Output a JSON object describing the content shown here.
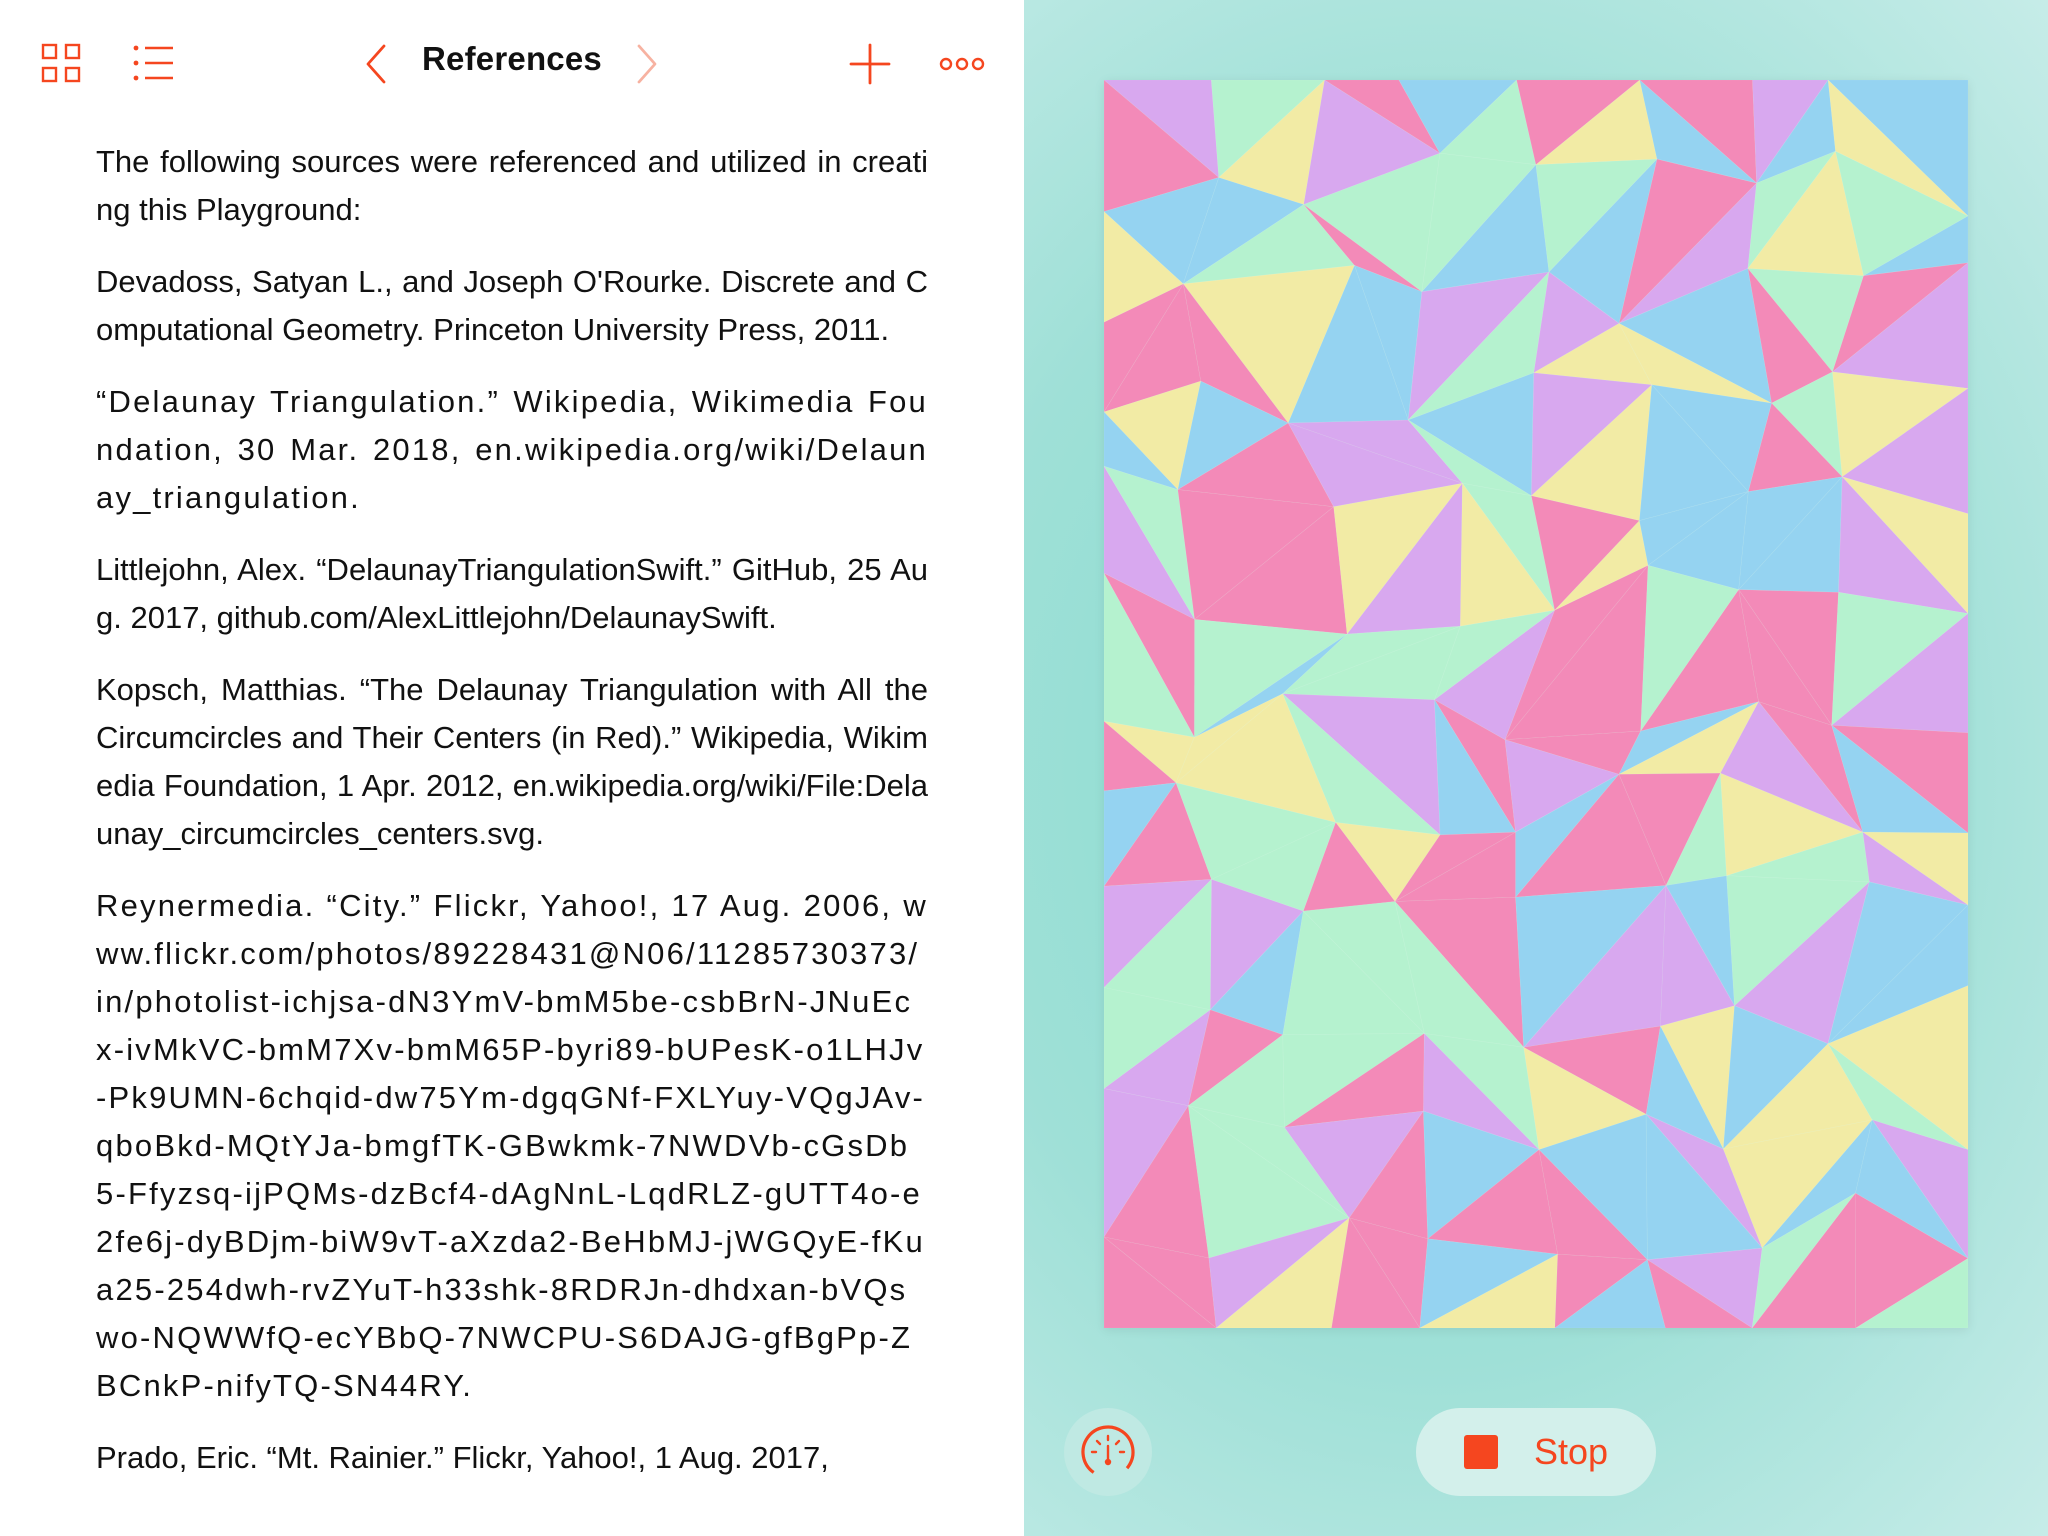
{
  "toolbar": {
    "title": "References",
    "icons": {
      "grid": "grid-view-icon",
      "list": "list-view-icon",
      "back": "chevron-left-icon",
      "forward": "chevron-right-icon",
      "add": "plus-icon",
      "more": "more-icon"
    }
  },
  "document": {
    "paragraphs": [
      "The following sources were referenced and utilized in creating this Playground:",
      "Devadoss, Satyan L., and Joseph O'Rourke. Discrete and Computational Geometry. Princeton University Press, 2011.",
      "“Delaunay Triangulation.” Wikipedia, Wikimedia Foundation, 30 Mar. 2018, en.wikipedia.org/wiki/Delaunay_triangulation.",
      "Littlejohn, Alex. “DelaunayTriangulationSwift.” GitHub, 25 Aug. 2017, github.com/AlexLittlejohn/DelaunaySwift.",
      "Kopsch, Matthias. “The Delaunay Triangulation with All the Circumcircles and Their Centers (in Red).” Wikipedia, Wikimedia Foundation, 1 Apr. 2012, en.wikipedia.org/wiki/File:Delaunay_circumcircles_centers.svg.",
      "Reynermedia. “City.” Flickr, Yahoo!, 17 Aug. 2006, www.flickr.com/photos/89228431@N06/11285730373/in/photolist-ichjsa-dN3YmV-bmM5be-csbBrN-JNuEcx-ivMkVC-bmM7Xv-bmM65P-byri89-bUPesK-o1LHJv-Pk9UMN-6chqid-dw75Ym-dgqGNf-FXLYuy-VQgJAv-qboBkd-MQtYJa-bmgfTK-GBwkmk-7NWDVb-cGsDb5-Ffyzsq-ijPQMs-dzBcf4-dAgNnL-LqdRLZ-gUTT4o-e2fe6j-dyBDjm-biW9vT-aXzda2-BeHbMJ-jWGQyE-fKua25-254dwh-rvZYuT-h33shk-8RDRJn-dhdxan-bVQswo-NQWWfQ-ecYBbQ-7NWCPU-S6DAJG-gfBgPp-ZBCnkP-nifyTQ-SN44RY.",
      "Prado, Eric. “Mt. Rainier.” Flickr, Yahoo!, 1 Aug. 2017,"
    ]
  },
  "live_view": {
    "palette": [
      "#f38ab8",
      "#95d3f1",
      "#b5f2cf",
      "#d8a8ef",
      "#f2eba5"
    ]
  },
  "controls": {
    "stop_label": "Stop",
    "gauge_icon": "speedometer-icon",
    "stop_icon": "stop-square-icon",
    "accent": "#f5461f"
  }
}
